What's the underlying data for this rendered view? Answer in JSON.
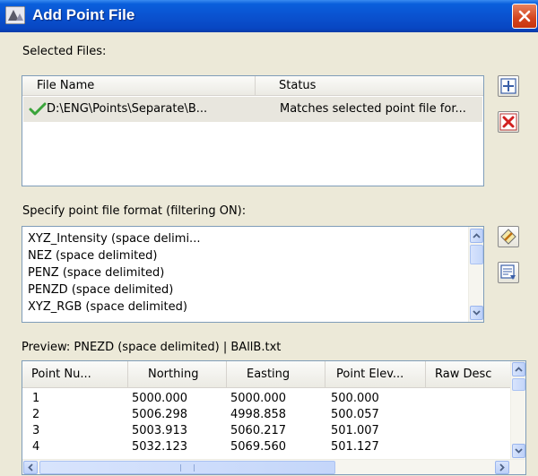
{
  "window": {
    "title": "Add Point File"
  },
  "selected_files": {
    "label": "Selected Files:",
    "columns": [
      "File Name",
      "Status"
    ],
    "rows": [
      {
        "file_name": "D:\\ENG\\Points\\Separate\\B...",
        "status": "Matches selected point file for...",
        "icon": "check-icon"
      }
    ]
  },
  "format": {
    "label": "Specify point file format (filtering ON):",
    "items": [
      "XYZ_Intensity (space delimi...",
      "NEZ (space delimited)",
      "PENZ (space delimited)",
      "PENZD (space delimited)",
      "XYZ_RGB (space delimited)"
    ]
  },
  "preview": {
    "label": "Preview: PNEZD (space delimited) | BAllB.txt",
    "columns": [
      "Point Nu...",
      "Northing",
      "Easting",
      "Point Elev...",
      "Raw Desc"
    ],
    "rows": [
      [
        "1",
        "5000.000",
        "5000.000",
        "500.000"
      ],
      [
        "2",
        "5006.298",
        "4998.858",
        "500.057"
      ],
      [
        "3",
        "5003.913",
        "5060.217",
        "501.007"
      ],
      [
        "4",
        "5032.123",
        "5069.560",
        "501.127"
      ]
    ]
  },
  "colors": {
    "titlebar": "#0a52d0",
    "dialog_bg": "#ece9d8",
    "border": "#7f9db9",
    "selection": "#e8e6de"
  }
}
